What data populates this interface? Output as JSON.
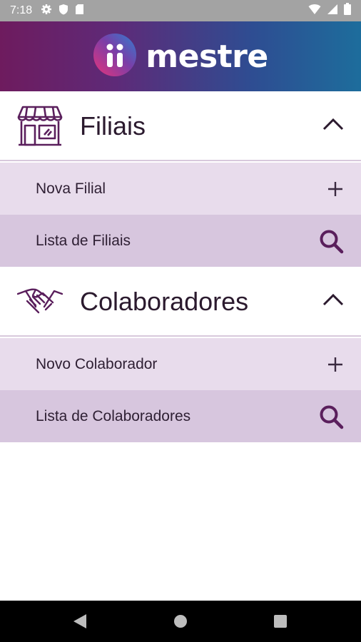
{
  "status_bar": {
    "time": "7:18",
    "left_icons": [
      "gear-icon",
      "shield-icon",
      "sd-card-icon"
    ],
    "right_icons": [
      "wifi-icon",
      "signal-icon",
      "battery-icon"
    ]
  },
  "header": {
    "brand": "mestre",
    "gradient": [
      "#6e1b5e",
      "#1d6d9c"
    ]
  },
  "sections": [
    {
      "title": "Filiais",
      "icon": "store-icon",
      "expanded": true,
      "items": [
        {
          "label": "Nova Filial",
          "icon": "plus-icon"
        },
        {
          "label": "Lista de Filiais",
          "icon": "search-icon"
        }
      ]
    },
    {
      "title": "Colaboradores",
      "icon": "handshake-icon",
      "expanded": true,
      "items": [
        {
          "label": "Novo Colaborador",
          "icon": "plus-icon"
        },
        {
          "label": "Lista de Colaboradores",
          "icon": "search-icon"
        }
      ]
    }
  ],
  "colors": {
    "accent": "#5a1f5c",
    "row_light": "#e8dcec",
    "row_dark": "#d7c6de"
  },
  "nav_bar": {
    "buttons": [
      "back-icon",
      "home-icon",
      "recents-icon"
    ]
  }
}
